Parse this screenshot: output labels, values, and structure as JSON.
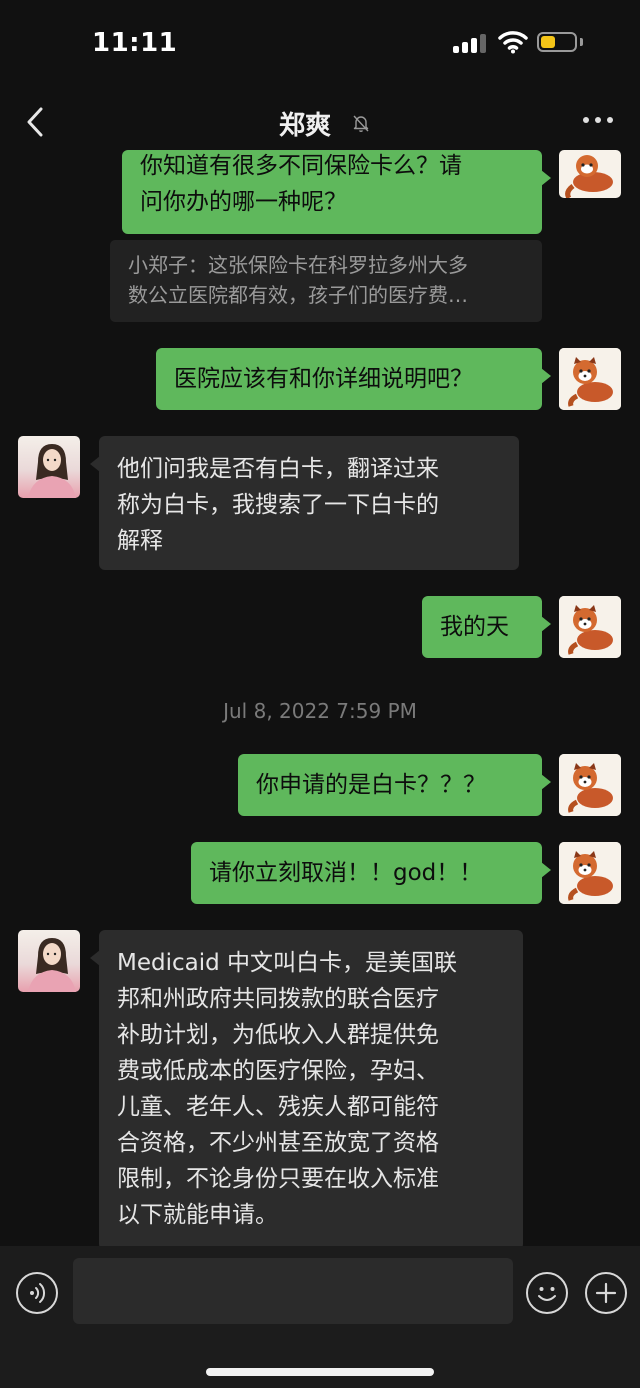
{
  "status_bar": {
    "time": "11:11"
  },
  "header": {
    "title": "郑爽"
  },
  "messages": [
    {
      "id": "m1",
      "dir": "out",
      "lines": [
        "你知道有很多不同保险卡么？请",
        "问你办的哪一种呢？"
      ]
    },
    {
      "id": "q1",
      "type": "quote",
      "lines": [
        "小郑子：这张保险卡在科罗拉多州大多",
        "数公立医院都有效，孩子们的医疗费…"
      ]
    },
    {
      "id": "m2",
      "dir": "out",
      "lines": [
        "医院应该有和你详细说明吧？"
      ]
    },
    {
      "id": "m3",
      "dir": "in",
      "lines": [
        "他们问我是否有白卡，翻译过来",
        "称为白卡，我搜索了一下白卡的",
        "解释"
      ]
    },
    {
      "id": "m4",
      "dir": "out",
      "lines": [
        "我的天"
      ]
    },
    {
      "id": "m5",
      "dir": "out",
      "lines": [
        "你申请的是白卡？？？"
      ]
    },
    {
      "id": "m6",
      "dir": "out",
      "lines": [
        "请你立刻取消！！god！！"
      ]
    },
    {
      "id": "m7",
      "dir": "in",
      "lines": [
        "Medicaid 中文叫白卡，是美国联",
        "邦和州政府共同拨款的联合医疗",
        "补助计划，为低收入人群提供免",
        "费或低成本的医疗保险，孕妇、",
        "儿童、老年人、残疾人都可能符",
        "合资格，不少州甚至放宽了资格",
        "限制，不论身份只要在收入标准",
        "以下就能申请。"
      ]
    }
  ],
  "timestamp": "Jul 8, 2022 7:59 PM",
  "colors": {
    "outgoing_bubble": "#5fb85c",
    "incoming_bubble": "#2c2c2c",
    "background": "#111111"
  },
  "icons": [
    "back-icon",
    "mute-icon",
    "more-icon",
    "voice-icon",
    "emoji-icon",
    "plus-icon"
  ]
}
